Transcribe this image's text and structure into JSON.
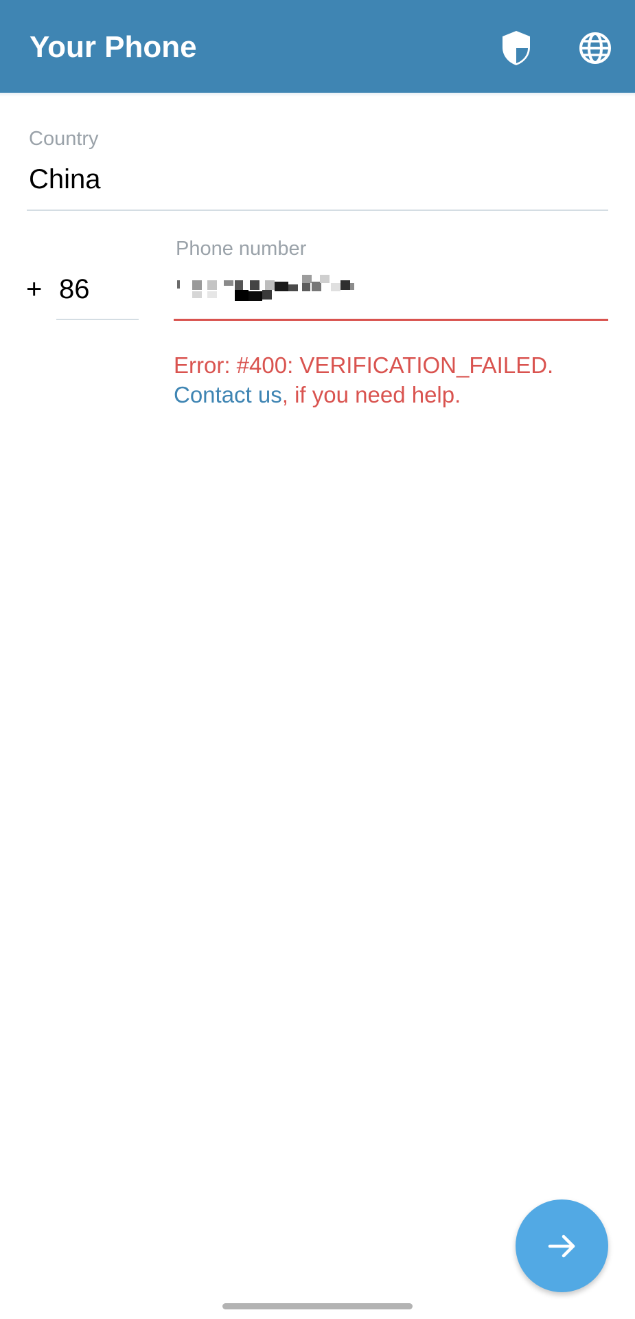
{
  "app_bar": {
    "title": "Your Phone",
    "background_color": "#3f85b3",
    "icons": [
      "shield-icon",
      "globe-icon"
    ]
  },
  "country": {
    "label": "Country",
    "value": "China"
  },
  "phone": {
    "plus": "+",
    "code": "86",
    "label": "Phone number",
    "value_redacted": true
  },
  "error": {
    "message": "Error: #400: VERIFICATION_FAILED.",
    "link_text": "Contact us",
    "suffix": ", if you need help.",
    "color": "#d9534f",
    "link_color": "#3f85b3"
  },
  "fab": {
    "icon": "arrow-right-icon",
    "color": "#52a9e4"
  }
}
